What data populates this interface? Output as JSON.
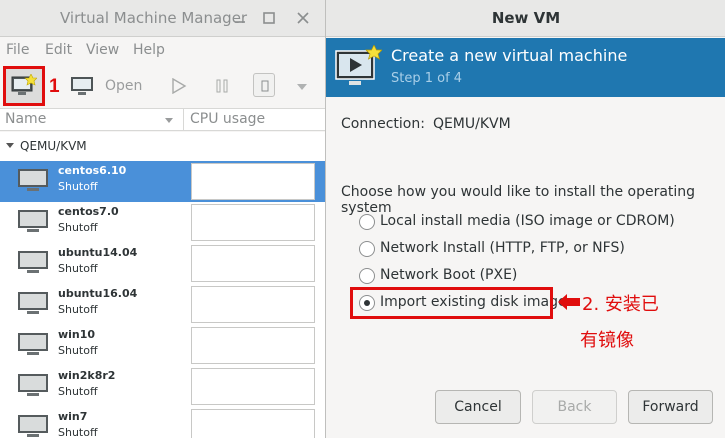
{
  "manager": {
    "title": "Virtual Machine Manager",
    "menu": [
      "File",
      "Edit",
      "View",
      "Help"
    ],
    "toolbar": {
      "open_label": "Open"
    },
    "annotation_step": "1",
    "columns": {
      "name": "Name",
      "cpu": "CPU usage"
    },
    "connection": "QEMU/KVM",
    "vms": [
      {
        "name": "centos6.10",
        "state": "Shutoff",
        "selected": true
      },
      {
        "name": "centos7.0",
        "state": "Shutoff"
      },
      {
        "name": "ubuntu14.04",
        "state": "Shutoff"
      },
      {
        "name": "ubuntu16.04",
        "state": "Shutoff"
      },
      {
        "name": "win10",
        "state": "Shutoff"
      },
      {
        "name": "win2k8r2",
        "state": "Shutoff"
      },
      {
        "name": "win7",
        "state": "Shutoff"
      }
    ]
  },
  "dialog": {
    "title": "New VM",
    "heading": "Create a new virtual machine",
    "step": "Step 1 of 4",
    "connection_label": "Connection:",
    "connection_value": "QEMU/KVM",
    "prompt": "Choose how you would like to install the operating system",
    "options": [
      {
        "label": "Local install media (ISO image or CDROM)",
        "selected": false
      },
      {
        "label": "Network Install (HTTP, FTP, or NFS)",
        "selected": false
      },
      {
        "label": "Network Boot (PXE)",
        "selected": false
      },
      {
        "label": "Import existing disk image",
        "selected": true
      }
    ],
    "annotation": {
      "line1": "2. 安装已",
      "line2": "有镜像"
    },
    "buttons": {
      "cancel": "Cancel",
      "back": "Back",
      "forward": "Forward"
    }
  },
  "colors": {
    "accent": "#1f77b0",
    "selection": "#4a90d9",
    "annotation": "#e00d0d"
  }
}
